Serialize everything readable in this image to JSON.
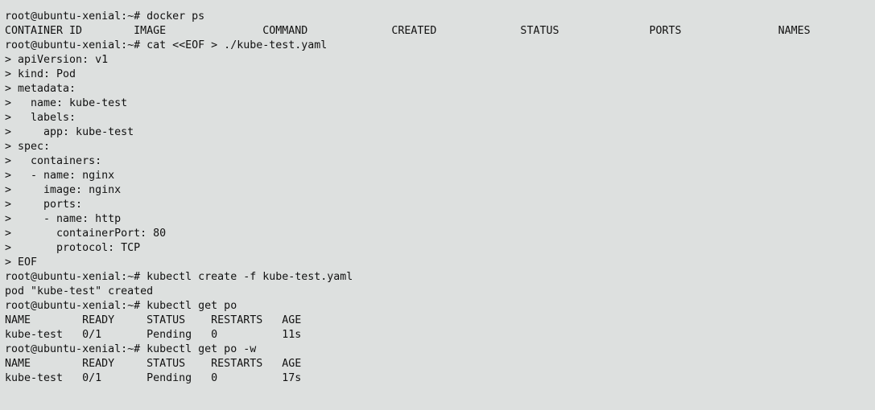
{
  "terminal": {
    "background": "#dde0df",
    "foreground": "#111111",
    "lines": [
      "",
      "root@ubuntu-xenial:~# docker ps",
      "CONTAINER ID        IMAGE               COMMAND             CREATED             STATUS              PORTS               NAMES",
      "root@ubuntu-xenial:~# cat <<EOF > ./kube-test.yaml",
      "> apiVersion: v1",
      "> kind: Pod",
      "> metadata:",
      ">   name: kube-test",
      ">   labels:",
      ">     app: kube-test",
      "> spec:",
      ">   containers:",
      ">   - name: nginx",
      ">     image: nginx",
      ">     ports:",
      ">     - name: http",
      ">       containerPort: 80",
      ">       protocol: TCP",
      "> EOF",
      "root@ubuntu-xenial:~# kubectl create -f kube-test.yaml",
      "pod \"kube-test\" created",
      "root@ubuntu-xenial:~# kubectl get po",
      "NAME        READY     STATUS    RESTARTS   AGE",
      "kube-test   0/1       Pending   0          11s",
      "root@ubuntu-xenial:~# kubectl get po -w",
      "NAME        READY     STATUS    RESTARTS   AGE",
      "kube-test   0/1       Pending   0          17s"
    ]
  }
}
